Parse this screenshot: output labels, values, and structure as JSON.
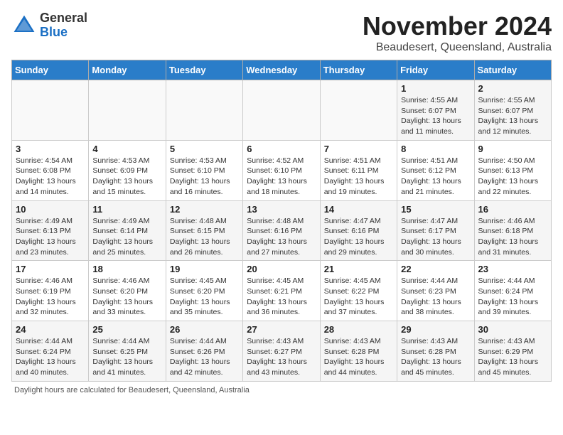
{
  "logo": {
    "general": "General",
    "blue": "Blue"
  },
  "title": "November 2024",
  "location": "Beaudesert, Queensland, Australia",
  "days_of_week": [
    "Sunday",
    "Monday",
    "Tuesday",
    "Wednesday",
    "Thursday",
    "Friday",
    "Saturday"
  ],
  "weeks": [
    [
      {
        "day": "",
        "info": ""
      },
      {
        "day": "",
        "info": ""
      },
      {
        "day": "",
        "info": ""
      },
      {
        "day": "",
        "info": ""
      },
      {
        "day": "",
        "info": ""
      },
      {
        "day": "1",
        "info": "Sunrise: 4:55 AM\nSunset: 6:07 PM\nDaylight: 13 hours and 11 minutes."
      },
      {
        "day": "2",
        "info": "Sunrise: 4:55 AM\nSunset: 6:07 PM\nDaylight: 13 hours and 12 minutes."
      }
    ],
    [
      {
        "day": "3",
        "info": "Sunrise: 4:54 AM\nSunset: 6:08 PM\nDaylight: 13 hours and 14 minutes."
      },
      {
        "day": "4",
        "info": "Sunrise: 4:53 AM\nSunset: 6:09 PM\nDaylight: 13 hours and 15 minutes."
      },
      {
        "day": "5",
        "info": "Sunrise: 4:53 AM\nSunset: 6:10 PM\nDaylight: 13 hours and 16 minutes."
      },
      {
        "day": "6",
        "info": "Sunrise: 4:52 AM\nSunset: 6:10 PM\nDaylight: 13 hours and 18 minutes."
      },
      {
        "day": "7",
        "info": "Sunrise: 4:51 AM\nSunset: 6:11 PM\nDaylight: 13 hours and 19 minutes."
      },
      {
        "day": "8",
        "info": "Sunrise: 4:51 AM\nSunset: 6:12 PM\nDaylight: 13 hours and 21 minutes."
      },
      {
        "day": "9",
        "info": "Sunrise: 4:50 AM\nSunset: 6:13 PM\nDaylight: 13 hours and 22 minutes."
      }
    ],
    [
      {
        "day": "10",
        "info": "Sunrise: 4:49 AM\nSunset: 6:13 PM\nDaylight: 13 hours and 23 minutes."
      },
      {
        "day": "11",
        "info": "Sunrise: 4:49 AM\nSunset: 6:14 PM\nDaylight: 13 hours and 25 minutes."
      },
      {
        "day": "12",
        "info": "Sunrise: 4:48 AM\nSunset: 6:15 PM\nDaylight: 13 hours and 26 minutes."
      },
      {
        "day": "13",
        "info": "Sunrise: 4:48 AM\nSunset: 6:16 PM\nDaylight: 13 hours and 27 minutes."
      },
      {
        "day": "14",
        "info": "Sunrise: 4:47 AM\nSunset: 6:16 PM\nDaylight: 13 hours and 29 minutes."
      },
      {
        "day": "15",
        "info": "Sunrise: 4:47 AM\nSunset: 6:17 PM\nDaylight: 13 hours and 30 minutes."
      },
      {
        "day": "16",
        "info": "Sunrise: 4:46 AM\nSunset: 6:18 PM\nDaylight: 13 hours and 31 minutes."
      }
    ],
    [
      {
        "day": "17",
        "info": "Sunrise: 4:46 AM\nSunset: 6:19 PM\nDaylight: 13 hours and 32 minutes."
      },
      {
        "day": "18",
        "info": "Sunrise: 4:46 AM\nSunset: 6:20 PM\nDaylight: 13 hours and 33 minutes."
      },
      {
        "day": "19",
        "info": "Sunrise: 4:45 AM\nSunset: 6:20 PM\nDaylight: 13 hours and 35 minutes."
      },
      {
        "day": "20",
        "info": "Sunrise: 4:45 AM\nSunset: 6:21 PM\nDaylight: 13 hours and 36 minutes."
      },
      {
        "day": "21",
        "info": "Sunrise: 4:45 AM\nSunset: 6:22 PM\nDaylight: 13 hours and 37 minutes."
      },
      {
        "day": "22",
        "info": "Sunrise: 4:44 AM\nSunset: 6:23 PM\nDaylight: 13 hours and 38 minutes."
      },
      {
        "day": "23",
        "info": "Sunrise: 4:44 AM\nSunset: 6:24 PM\nDaylight: 13 hours and 39 minutes."
      }
    ],
    [
      {
        "day": "24",
        "info": "Sunrise: 4:44 AM\nSunset: 6:24 PM\nDaylight: 13 hours and 40 minutes."
      },
      {
        "day": "25",
        "info": "Sunrise: 4:44 AM\nSunset: 6:25 PM\nDaylight: 13 hours and 41 minutes."
      },
      {
        "day": "26",
        "info": "Sunrise: 4:44 AM\nSunset: 6:26 PM\nDaylight: 13 hours and 42 minutes."
      },
      {
        "day": "27",
        "info": "Sunrise: 4:43 AM\nSunset: 6:27 PM\nDaylight: 13 hours and 43 minutes."
      },
      {
        "day": "28",
        "info": "Sunrise: 4:43 AM\nSunset: 6:28 PM\nDaylight: 13 hours and 44 minutes."
      },
      {
        "day": "29",
        "info": "Sunrise: 4:43 AM\nSunset: 6:28 PM\nDaylight: 13 hours and 45 minutes."
      },
      {
        "day": "30",
        "info": "Sunrise: 4:43 AM\nSunset: 6:29 PM\nDaylight: 13 hours and 45 minutes."
      }
    ]
  ],
  "footer_note": "Daylight hours are calculated for Beaudesert, Queensland, Australia"
}
